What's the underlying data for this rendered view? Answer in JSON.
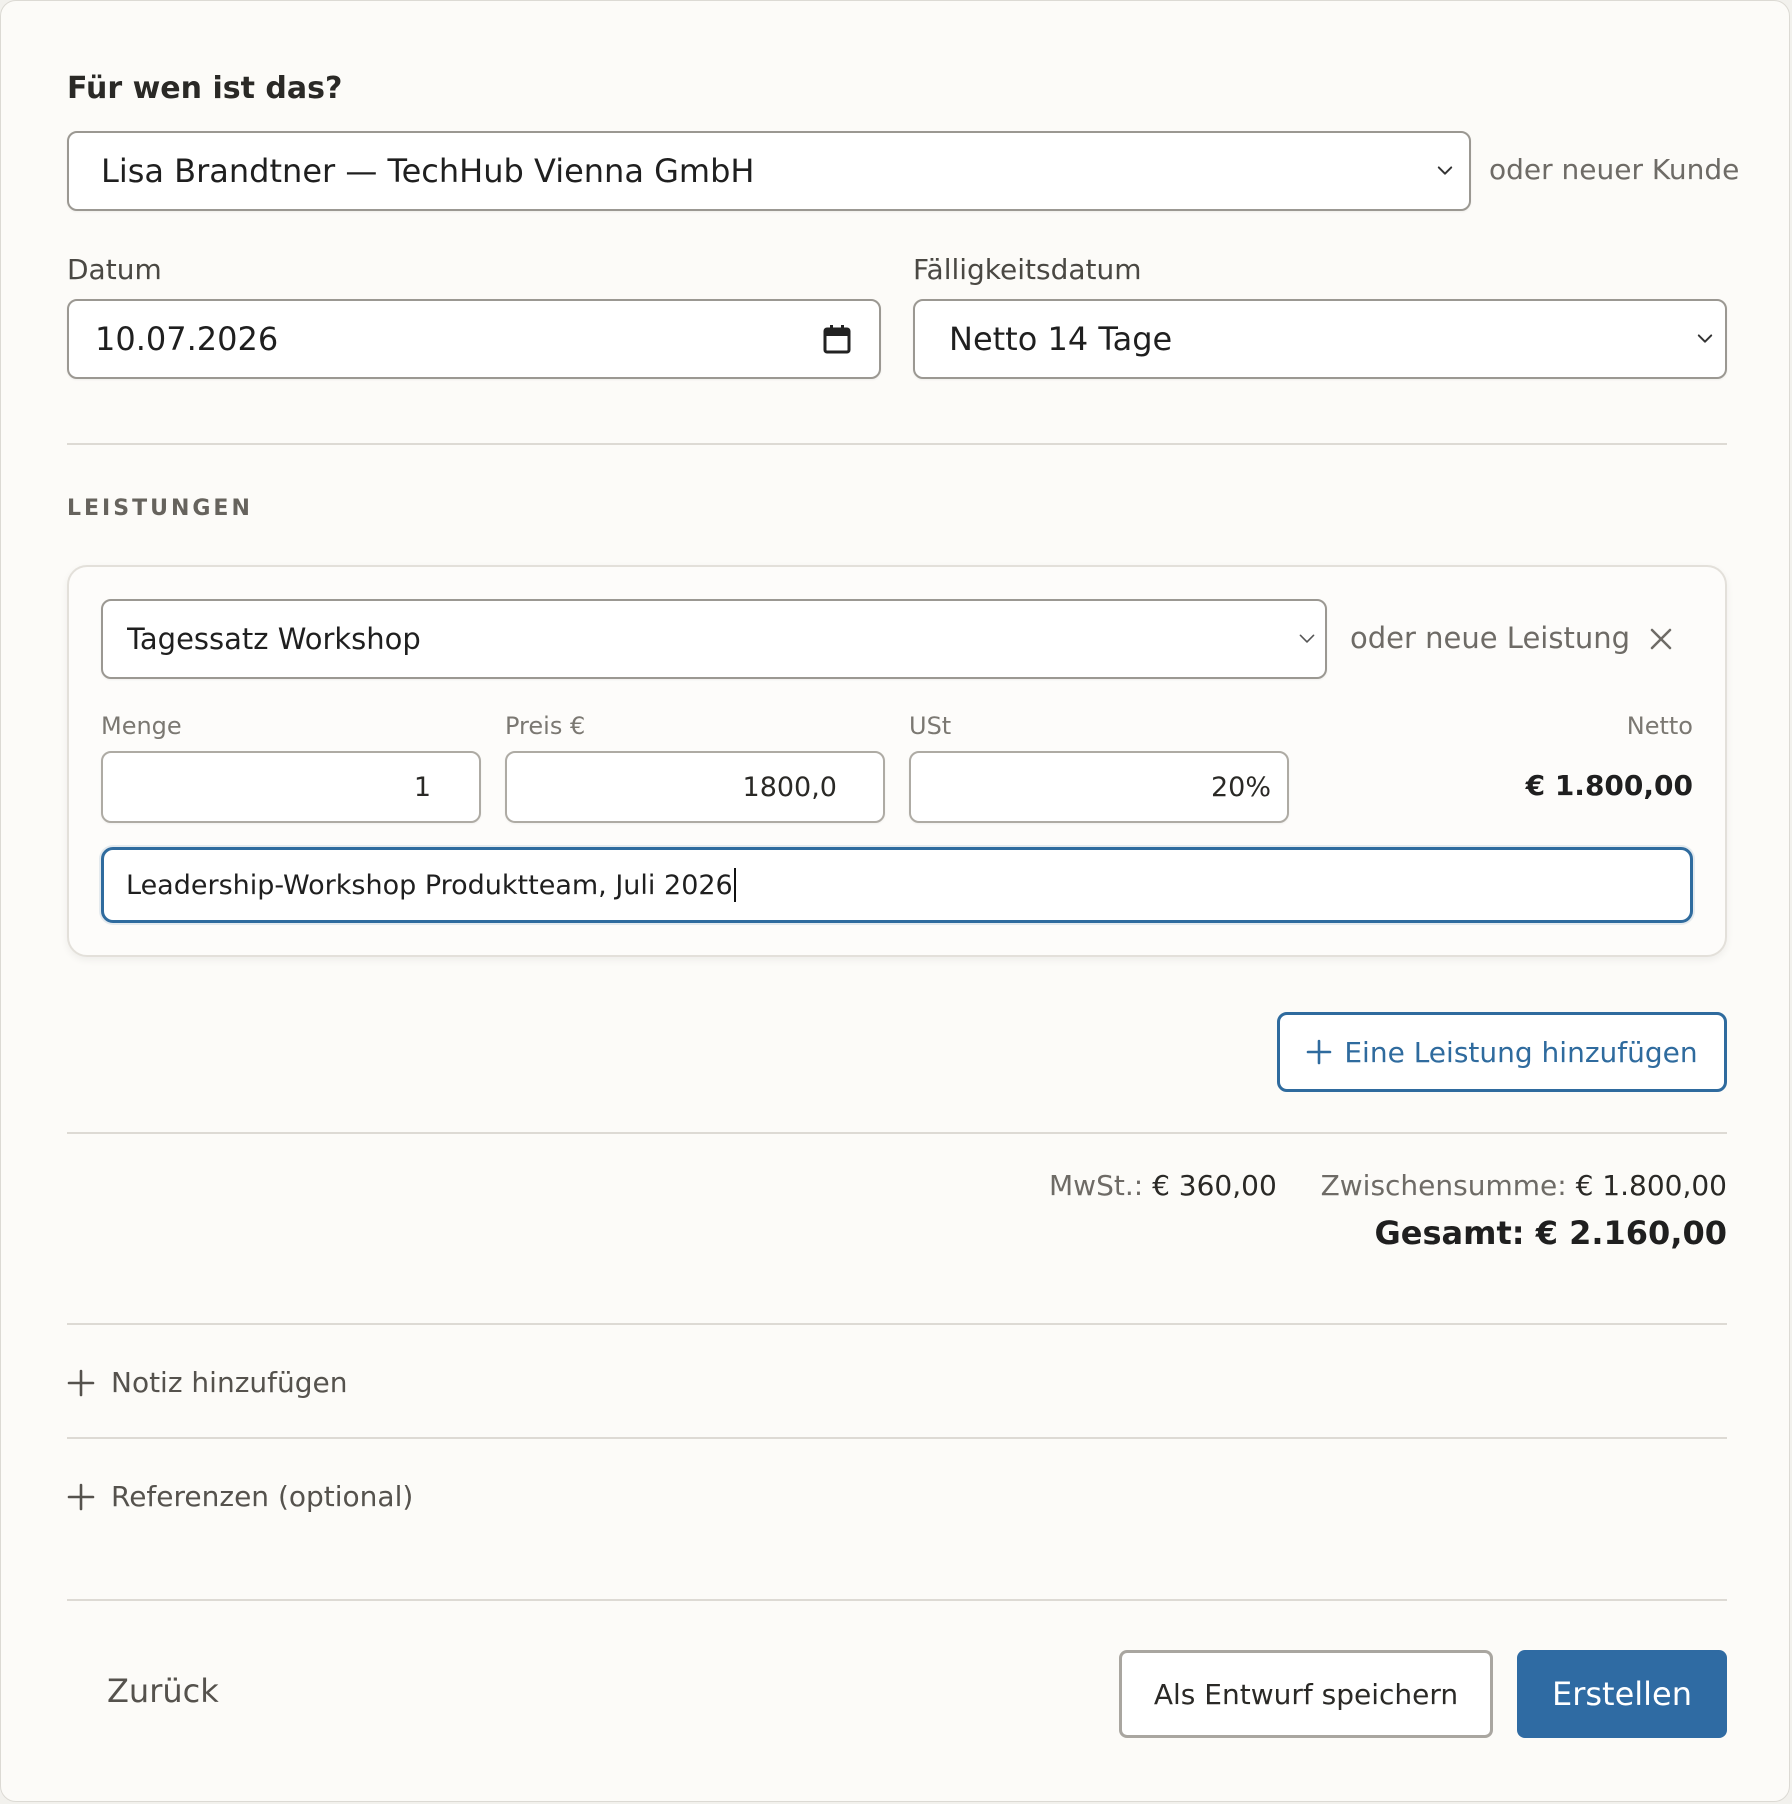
{
  "customer_section": {
    "title": "Für wen ist das?",
    "selected_customer": "Lisa Brandtner — TechHub Vienna GmbH",
    "new_customer_link": "oder neuer Kunde"
  },
  "dates": {
    "date_label": "Datum",
    "date_value": "10.07.2026",
    "due_label": "Fälligkeitsdatum",
    "due_value": "Netto 14 Tage"
  },
  "services": {
    "heading": "LEISTUNGEN",
    "item": {
      "selected_service": "Tagessatz Workshop",
      "new_service_link": "oder neue Leistung",
      "quantity_label": "Menge",
      "quantity_value": "1",
      "price_label": "Preis €",
      "price_value": "1800,0",
      "vat_label": "USt",
      "vat_value": "20%",
      "net_label": "Netto",
      "net_value": "€ 1.800,00",
      "description_value": "Leadership-Workshop Produktteam, Juli 2026"
    },
    "add_button_label": "Eine Leistung hinzufügen"
  },
  "totals": {
    "vat_label": "MwSt.:",
    "vat_value": "€ 360,00",
    "subtotal_label": "Zwischensumme:",
    "subtotal_value": "€ 1.800,00",
    "total_label": "Gesamt:",
    "total_value": "€ 2.160,00"
  },
  "extras": {
    "add_note_label": "Notiz hinzufügen",
    "references_label": "Referenzen (optional)"
  },
  "footer": {
    "back_label": "Zurück",
    "draft_label": "Als Entwurf speichern",
    "create_label": "Erstellen"
  },
  "colors": {
    "accent": "#2f6ba3",
    "background": "#fcfbf8",
    "border": "#9b9892"
  },
  "icons": [
    "chevron-down-icon",
    "calendar-icon",
    "close-icon",
    "plus-icon"
  ]
}
